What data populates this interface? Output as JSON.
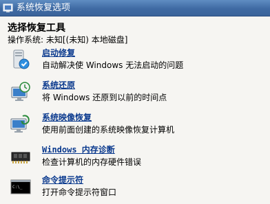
{
  "window": {
    "title": "系统恢复选项"
  },
  "page": {
    "heading": "选择恢复工具",
    "os_line": "操作系统: 未知[(未知) 本地磁盘]"
  },
  "tools": [
    {
      "name": "启动修复",
      "desc": "自动解决使 Windows 无法启动的问题",
      "icon": "startup-repair-icon"
    },
    {
      "name": "系统还原",
      "desc": "将 Windows 还原到以前的时间点",
      "icon": "system-restore-icon"
    },
    {
      "name": "系统映像恢复",
      "desc": "使用前面创建的系统映像恢复计算机",
      "icon": "system-image-recovery-icon"
    },
    {
      "name": "Windows 内存诊断",
      "desc": "检查计算机的内存硬件错误",
      "icon": "memory-chip-icon"
    },
    {
      "name": "命令提示符",
      "desc": "打开命令提示符窗口",
      "icon": "command-prompt-icon"
    }
  ]
}
